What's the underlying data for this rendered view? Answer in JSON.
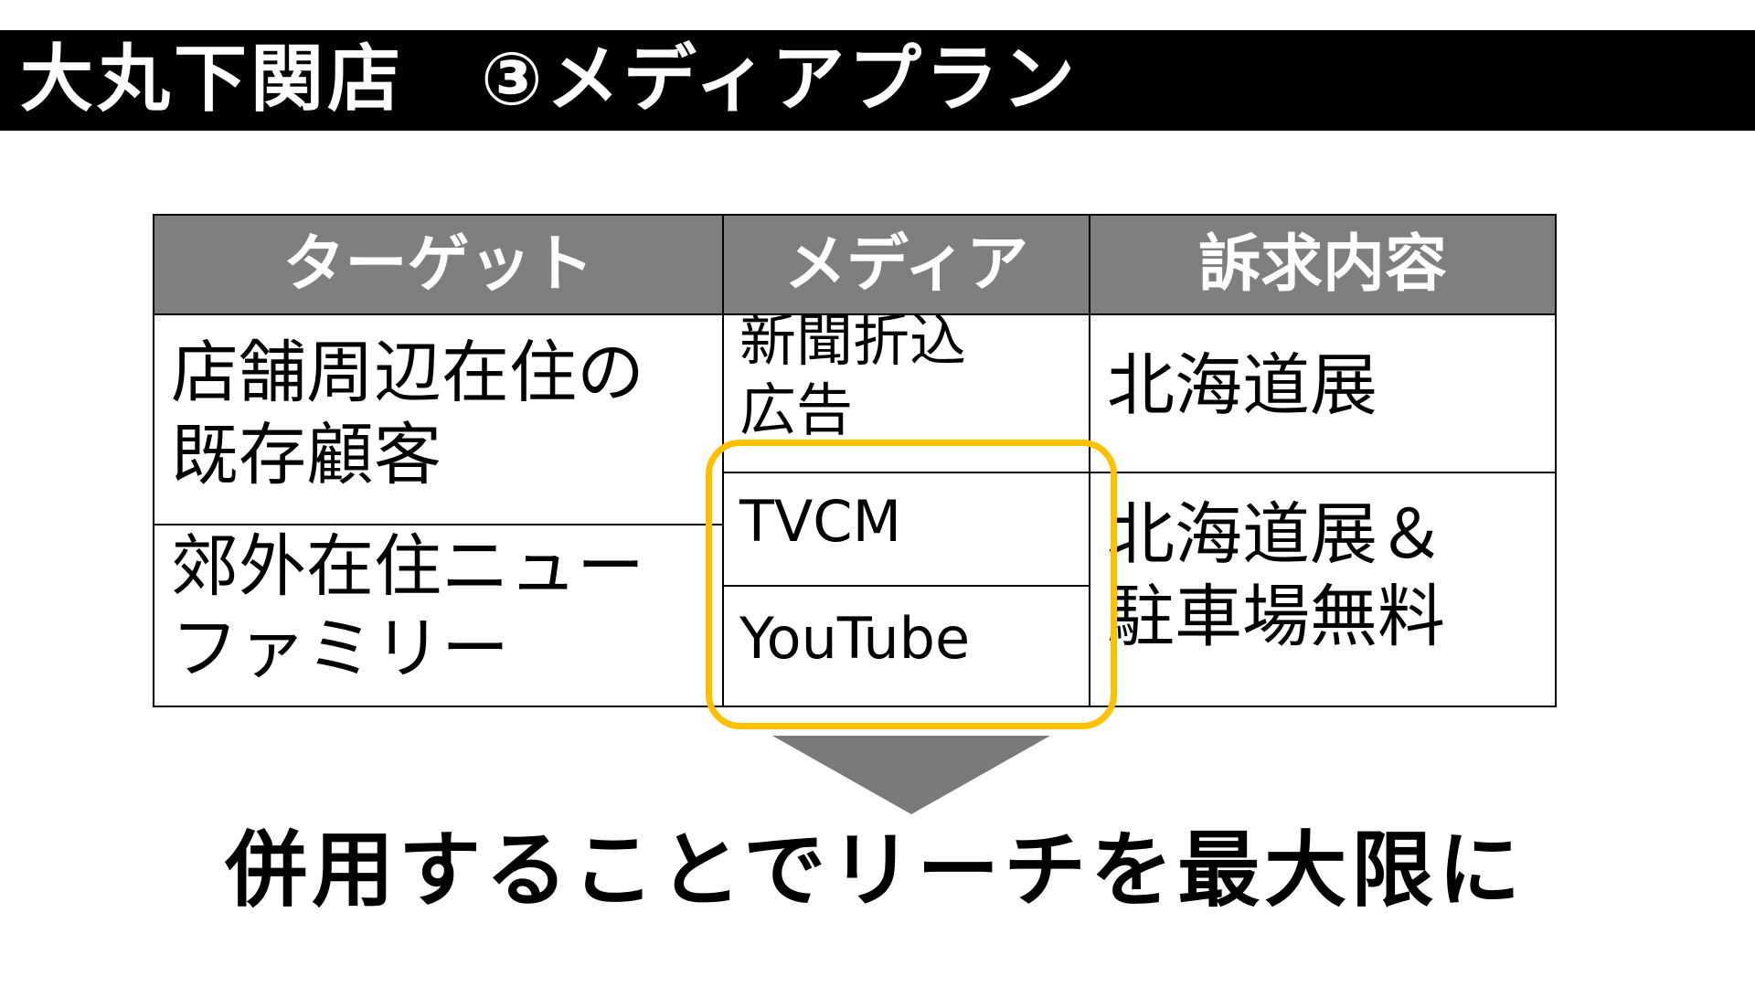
{
  "slide": {
    "title": "大丸下関店　③メディアプラン",
    "conclusion": "併用することでリーチを最大限に"
  },
  "table": {
    "headers": [
      "ターゲット",
      "メディア",
      "訴求内容"
    ],
    "targets": [
      {
        "lines": [
          "店舗周辺在住の",
          "既存顧客"
        ]
      },
      {
        "lines": [
          "郊外在住ニュー",
          "ファミリー"
        ]
      }
    ],
    "media": [
      {
        "lines": [
          "新聞折込",
          "広告"
        ]
      },
      {
        "lines": [
          "TVCM"
        ]
      },
      {
        "lines": [
          "YouTube"
        ]
      }
    ],
    "appeals": [
      {
        "lines": [
          "北海道展"
        ]
      },
      {
        "lines": [
          "北海道展＆",
          "駐車場無料"
        ]
      }
    ]
  },
  "highlight": {
    "label": "TVCM + YouTube highlighted",
    "color": "#FFC000"
  },
  "colors": {
    "title_bar": "#000000",
    "header_bg": "#7F7F7F",
    "arrow": "#7A7A7A"
  }
}
